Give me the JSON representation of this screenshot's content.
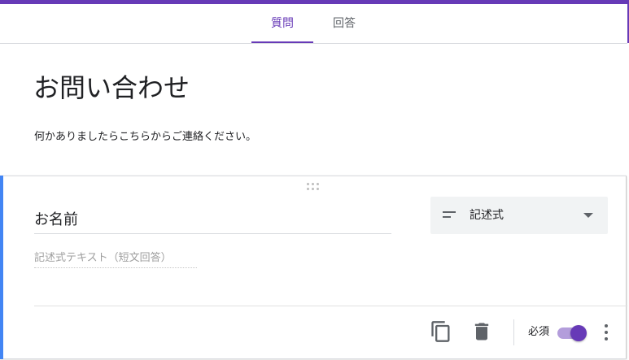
{
  "tabs": {
    "questions": "質問",
    "responses": "回答"
  },
  "form": {
    "title": "お問い合わせ",
    "description": "何かありましたらこちらからご連絡ください。"
  },
  "question": {
    "title": "お名前",
    "type_label": "記述式",
    "answer_placeholder": "記述式テキスト（短文回答）",
    "required_label": "必須",
    "required": true
  },
  "icons": {
    "drag": "drag-handle-icon",
    "short_answer": "short-answer-icon",
    "dropdown": "chevron-down-icon",
    "copy": "copy-icon",
    "delete": "trash-icon",
    "more": "more-vert-icon"
  },
  "colors": {
    "accent": "#673ab7",
    "active_card": "#4285f4",
    "toggle_track": "#b39ddb"
  }
}
